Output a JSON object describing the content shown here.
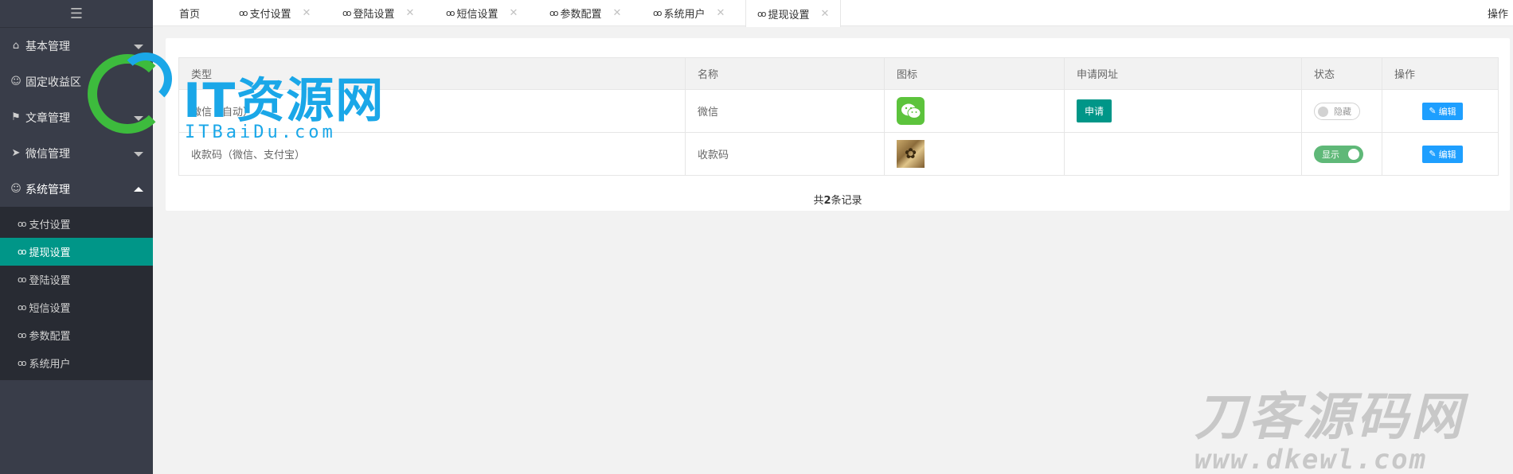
{
  "sidebar": {
    "toggle_icon": "menu-toggle-icon",
    "groups": [
      {
        "label": "基本管理",
        "icon": "home-icon",
        "state": "collapsed"
      },
      {
        "label": "固定收益区",
        "icon": "user-icon",
        "state": "none"
      },
      {
        "label": "文章管理",
        "icon": "flag-icon",
        "state": "collapsed"
      },
      {
        "label": "微信管理",
        "icon": "send-icon",
        "state": "collapsed"
      },
      {
        "label": "系统管理",
        "icon": "user-icon",
        "state": "expanded"
      }
    ],
    "subitems": [
      {
        "label": "支付设置",
        "active": false
      },
      {
        "label": "提现设置",
        "active": true
      },
      {
        "label": "登陆设置",
        "active": false
      },
      {
        "label": "短信设置",
        "active": false
      },
      {
        "label": "参数配置",
        "active": false
      },
      {
        "label": "系统用户",
        "active": false
      }
    ]
  },
  "tabs": {
    "home": "首页",
    "items": [
      {
        "label": "支付设置"
      },
      {
        "label": "登陆设置"
      },
      {
        "label": "短信设置"
      },
      {
        "label": "参数配置"
      },
      {
        "label": "系统用户"
      },
      {
        "label": "提现设置",
        "active": true
      }
    ],
    "ops_label": "操作"
  },
  "table": {
    "headers": [
      "类型",
      "名称",
      "图标",
      "申请网址",
      "状态",
      "操作"
    ],
    "rows": [
      {
        "type": "微信（自动）",
        "name": "微信",
        "icon": "wechat-icon",
        "apply_label": "申请",
        "status": "隐藏",
        "status_on": false,
        "edit_label": "编辑"
      },
      {
        "type": "收款码（微信、支付宝）",
        "name": "收款码",
        "icon": "qr-code-image",
        "apply_label": "",
        "status": "显示",
        "status_on": true,
        "edit_label": "编辑"
      }
    ],
    "footer_prefix": "共",
    "footer_count": "2",
    "footer_suffix": "条记录"
  },
  "watermarks": {
    "top_title": "IT资源网",
    "top_sub": "ITBaiDu.com",
    "bottom_title": "刀客源码网",
    "bottom_sub": "www.dkewl.com"
  },
  "colors": {
    "sidebar_bg": "#393d49",
    "active_green": "#009688",
    "edit_blue": "#1e9fff",
    "switch_on": "#5fb878"
  }
}
